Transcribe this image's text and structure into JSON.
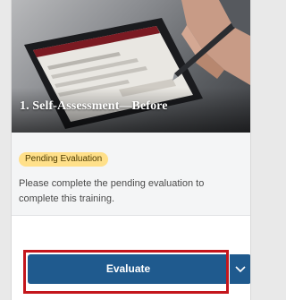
{
  "card": {
    "title": "1. Self-Assessment—Before",
    "badge": "Pending Evaluation",
    "description": "Please complete the pending evaluation to complete this training.",
    "image_subject": "hand-with-stylus-on-tablet"
  },
  "actions": {
    "primary_label": "Evaluate",
    "menu_icon": "chevron-down-icon"
  },
  "colors": {
    "primary": "#1f5a8e",
    "badge_bg": "#ffe08a",
    "highlight": "#c4161c"
  }
}
